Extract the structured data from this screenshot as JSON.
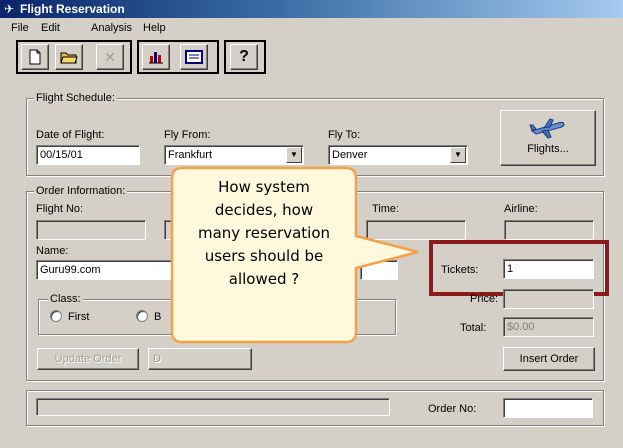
{
  "window": {
    "title": "Flight Reservation"
  },
  "menu": [
    "File",
    "Edit",
    "Analysis",
    "Help"
  ],
  "toolbar": {
    "icons": [
      "new-document-icon",
      "open-folder-icon",
      "delete-icon",
      "graph-icon",
      "report-icon",
      "help-icon"
    ],
    "help_label": "?"
  },
  "schedule": {
    "legend": "Flight Schedule:",
    "date_label": "Date of Flight:",
    "date_value": "00/15/01",
    "from_label": "Fly From:",
    "from_value": "Frankfurt",
    "to_label": "Fly To:",
    "to_value": "Denver",
    "flights_button": "Flights..."
  },
  "order": {
    "legend": "Order Information:",
    "flight_no_label": "Flight No:",
    "time_label": "Time:",
    "airline_label": "Airline:",
    "name_label": "Name:",
    "name_value": "Guru99.com",
    "tickets_label": "Tickets:",
    "tickets_value": "1",
    "price_label": "Price:",
    "total_label": "Total:",
    "total_value": "$0.00",
    "class_legend": "Class:",
    "class_first": "First",
    "class_business_initial": "B",
    "insert_button": "Insert Order",
    "update_button": "Update Order",
    "delete_button_partial": "D"
  },
  "status": {
    "order_no_label": "Order No:"
  },
  "callout": {
    "lines": [
      "How system",
      "decides, how",
      "many reservation",
      "users should be",
      "allowed ?"
    ]
  },
  "colors": {
    "highlight": "#8b1a1a",
    "callout_fill": "#fff8dc",
    "callout_border": "#f4a14a"
  }
}
